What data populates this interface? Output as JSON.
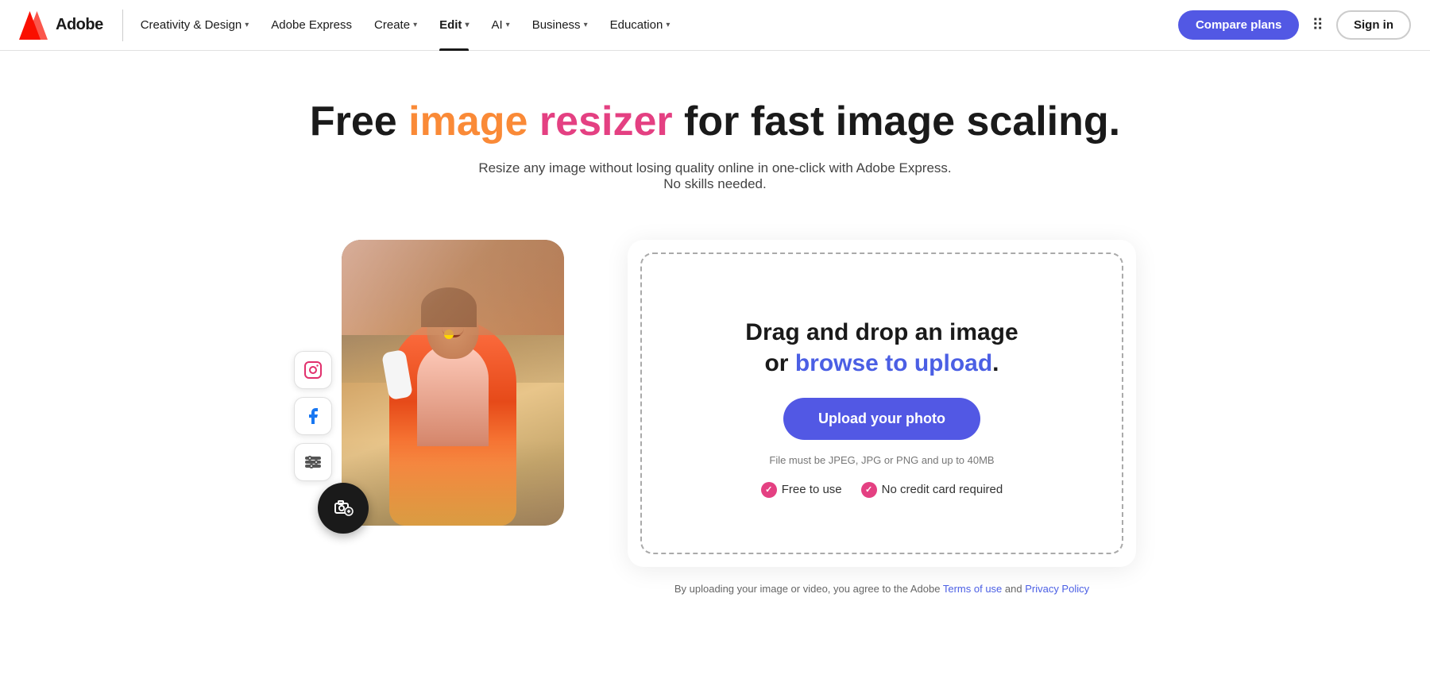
{
  "nav": {
    "logo_text": "Adobe",
    "items": [
      {
        "label": "Creativity & Design",
        "chevron": true,
        "active": false
      },
      {
        "label": "Adobe Express",
        "chevron": false,
        "active": false
      },
      {
        "label": "Create",
        "chevron": true,
        "active": false
      },
      {
        "label": "Edit",
        "chevron": true,
        "active": true
      },
      {
        "label": "AI",
        "chevron": true,
        "active": false
      },
      {
        "label": "Business",
        "chevron": true,
        "active": false
      },
      {
        "label": "Education",
        "chevron": true,
        "active": false
      }
    ],
    "compare_plans": "Compare plans",
    "sign_in": "Sign in"
  },
  "hero": {
    "title_prefix": "Free ",
    "title_image": "image",
    "title_space1": " ",
    "title_resizer": "resizer",
    "title_suffix": " for fast image scaling.",
    "subtitle": "Resize any image without losing quality online in one-click with Adobe Express. No skills needed."
  },
  "social_icons": [
    {
      "name": "instagram",
      "symbol": "📷"
    },
    {
      "name": "facebook",
      "symbol": "f"
    },
    {
      "name": "settings",
      "symbol": "⚙"
    }
  ],
  "upload": {
    "drag_text": "Drag and drop an image",
    "or_text": "or ",
    "browse_text": "browse to upload",
    "period": ".",
    "btn_label": "Upload your photo",
    "hint": "File must be JPEG, JPG or PNG and up to 40MB",
    "badge1": "Free to use",
    "badge2": "No credit card required",
    "terms_prefix": "By uploading your image or video, you agree to the Adobe ",
    "terms_link1": "Terms of use",
    "terms_and": " and ",
    "terms_link2": "Privacy Policy"
  }
}
